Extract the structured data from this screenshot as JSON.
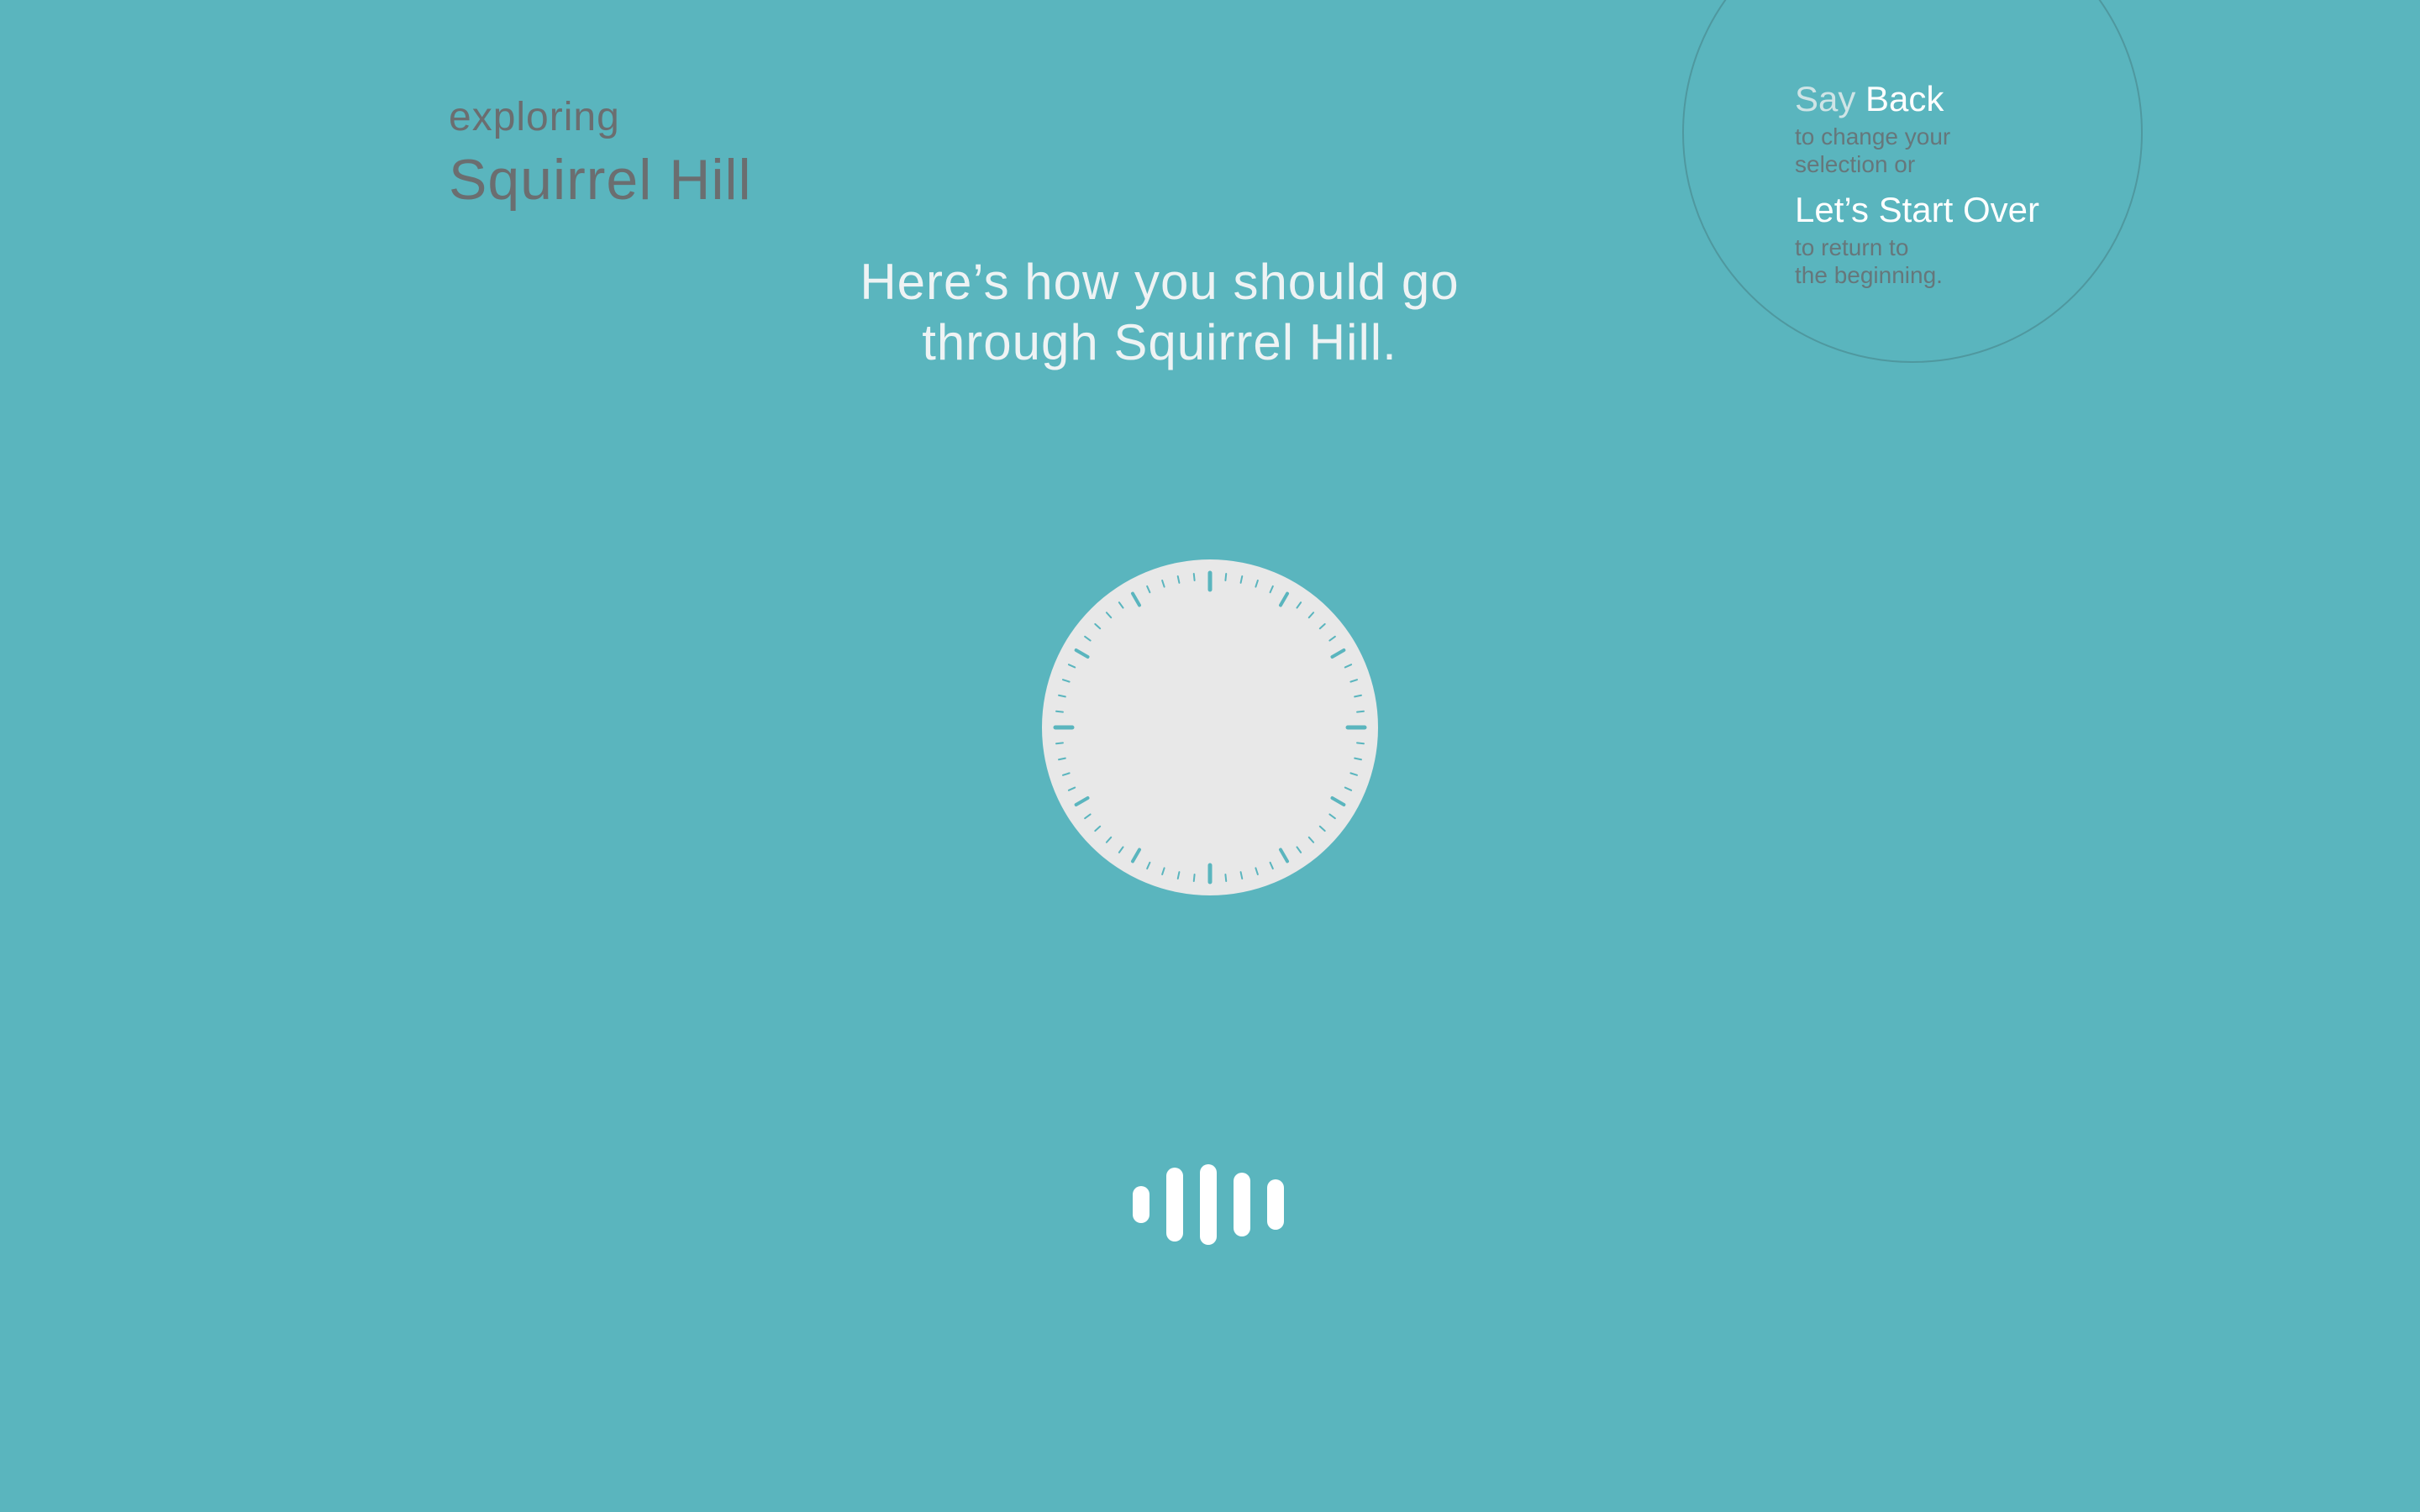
{
  "location": {
    "kicker": "exploring",
    "name": "Squirrel Hill"
  },
  "prompt": {
    "line1": "Here’s how you should go",
    "line2": "through Squirrel Hill."
  },
  "hint": {
    "say": "Say",
    "back": "Back",
    "back_desc_1": "to change your",
    "back_desc_2": "selection or",
    "start_over": "Let’s Start Over",
    "start_desc_1": "to return to",
    "start_desc_2": "the beginning."
  },
  "colors": {
    "background": "#5ab5be",
    "dial_face": "#e8e8e8",
    "dial_ticks": "#5ab5be",
    "accent_text": "#eef3f4"
  },
  "icons": {
    "dial": "clock-dial-icon",
    "voice": "voice-waveform-icon"
  }
}
